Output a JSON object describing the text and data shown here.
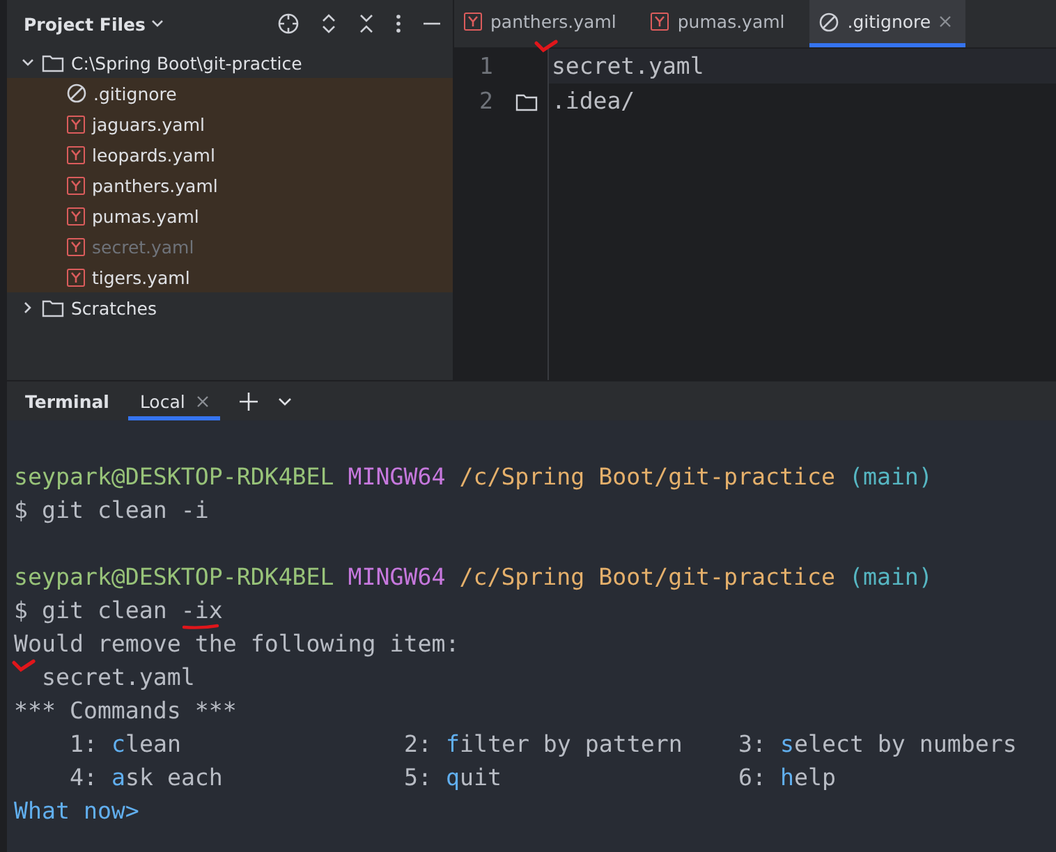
{
  "project_panel": {
    "title": "Project Files",
    "tree": [
      {
        "name": "C:\\Spring Boot\\git-practice",
        "kind": "folder",
        "expanded": true,
        "children": [
          {
            "name": ".gitignore",
            "kind": "gitignore",
            "ignored": false
          },
          {
            "name": "jaguars.yaml",
            "kind": "yaml",
            "ignored": false
          },
          {
            "name": "leopards.yaml",
            "kind": "yaml",
            "ignored": false
          },
          {
            "name": "panthers.yaml",
            "kind": "yaml",
            "ignored": false
          },
          {
            "name": "pumas.yaml",
            "kind": "yaml",
            "ignored": false
          },
          {
            "name": "secret.yaml",
            "kind": "yaml",
            "ignored": true
          },
          {
            "name": "tigers.yaml",
            "kind": "yaml",
            "ignored": false
          }
        ]
      },
      {
        "name": "Scratches",
        "kind": "folder",
        "expanded": false
      }
    ]
  },
  "editor": {
    "tabs": [
      {
        "label": "panthers.yaml",
        "kind": "yaml",
        "selected": false
      },
      {
        "label": "pumas.yaml",
        "kind": "yaml",
        "selected": false
      },
      {
        "label": ".gitignore",
        "kind": "gitignore",
        "selected": true
      }
    ],
    "lines": [
      {
        "number": "1",
        "text": "secret.yaml",
        "current": true
      },
      {
        "number": "2",
        "text": ".idea/",
        "current": false,
        "folder_marker": true
      }
    ]
  },
  "terminal": {
    "title": "Terminal",
    "tabs": [
      {
        "label": "Local",
        "selected": true
      }
    ],
    "lines": [
      {
        "kind": "blank"
      },
      {
        "kind": "prompt",
        "user": "seypark@DESKTOP-RDK4BEL",
        "system": "MINGW64",
        "path": "/c/Spring Boot/git-practice",
        "branch": "(main)"
      },
      {
        "kind": "command",
        "text": "$ git clean -i"
      },
      {
        "kind": "blank"
      },
      {
        "kind": "prompt",
        "user": "seypark@DESKTOP-RDK4BEL",
        "system": "MINGW64",
        "path": "/c/Spring Boot/git-practice",
        "branch": "(main)"
      },
      {
        "kind": "command",
        "text": "$ git clean -ix"
      },
      {
        "kind": "output",
        "text": "Would remove the following item:"
      },
      {
        "kind": "item",
        "text": "secret.yaml"
      },
      {
        "kind": "output",
        "text": "*** Commands ***"
      },
      {
        "kind": "menu",
        "items": [
          {
            "number": "1:",
            "key": "c",
            "rest": "lean"
          },
          {
            "number": "2:",
            "key": "f",
            "rest": "ilter by pattern"
          },
          {
            "number": "3:",
            "key": "s",
            "rest": "elect by numbers"
          }
        ]
      },
      {
        "kind": "menu",
        "items": [
          {
            "number": "4:",
            "key": "a",
            "rest": "sk each"
          },
          {
            "number": "5:",
            "key": "q",
            "rest": "uit"
          },
          {
            "number": "6:",
            "key": "h",
            "rest": "elp"
          }
        ]
      },
      {
        "kind": "input",
        "text": "What now>"
      }
    ]
  }
}
